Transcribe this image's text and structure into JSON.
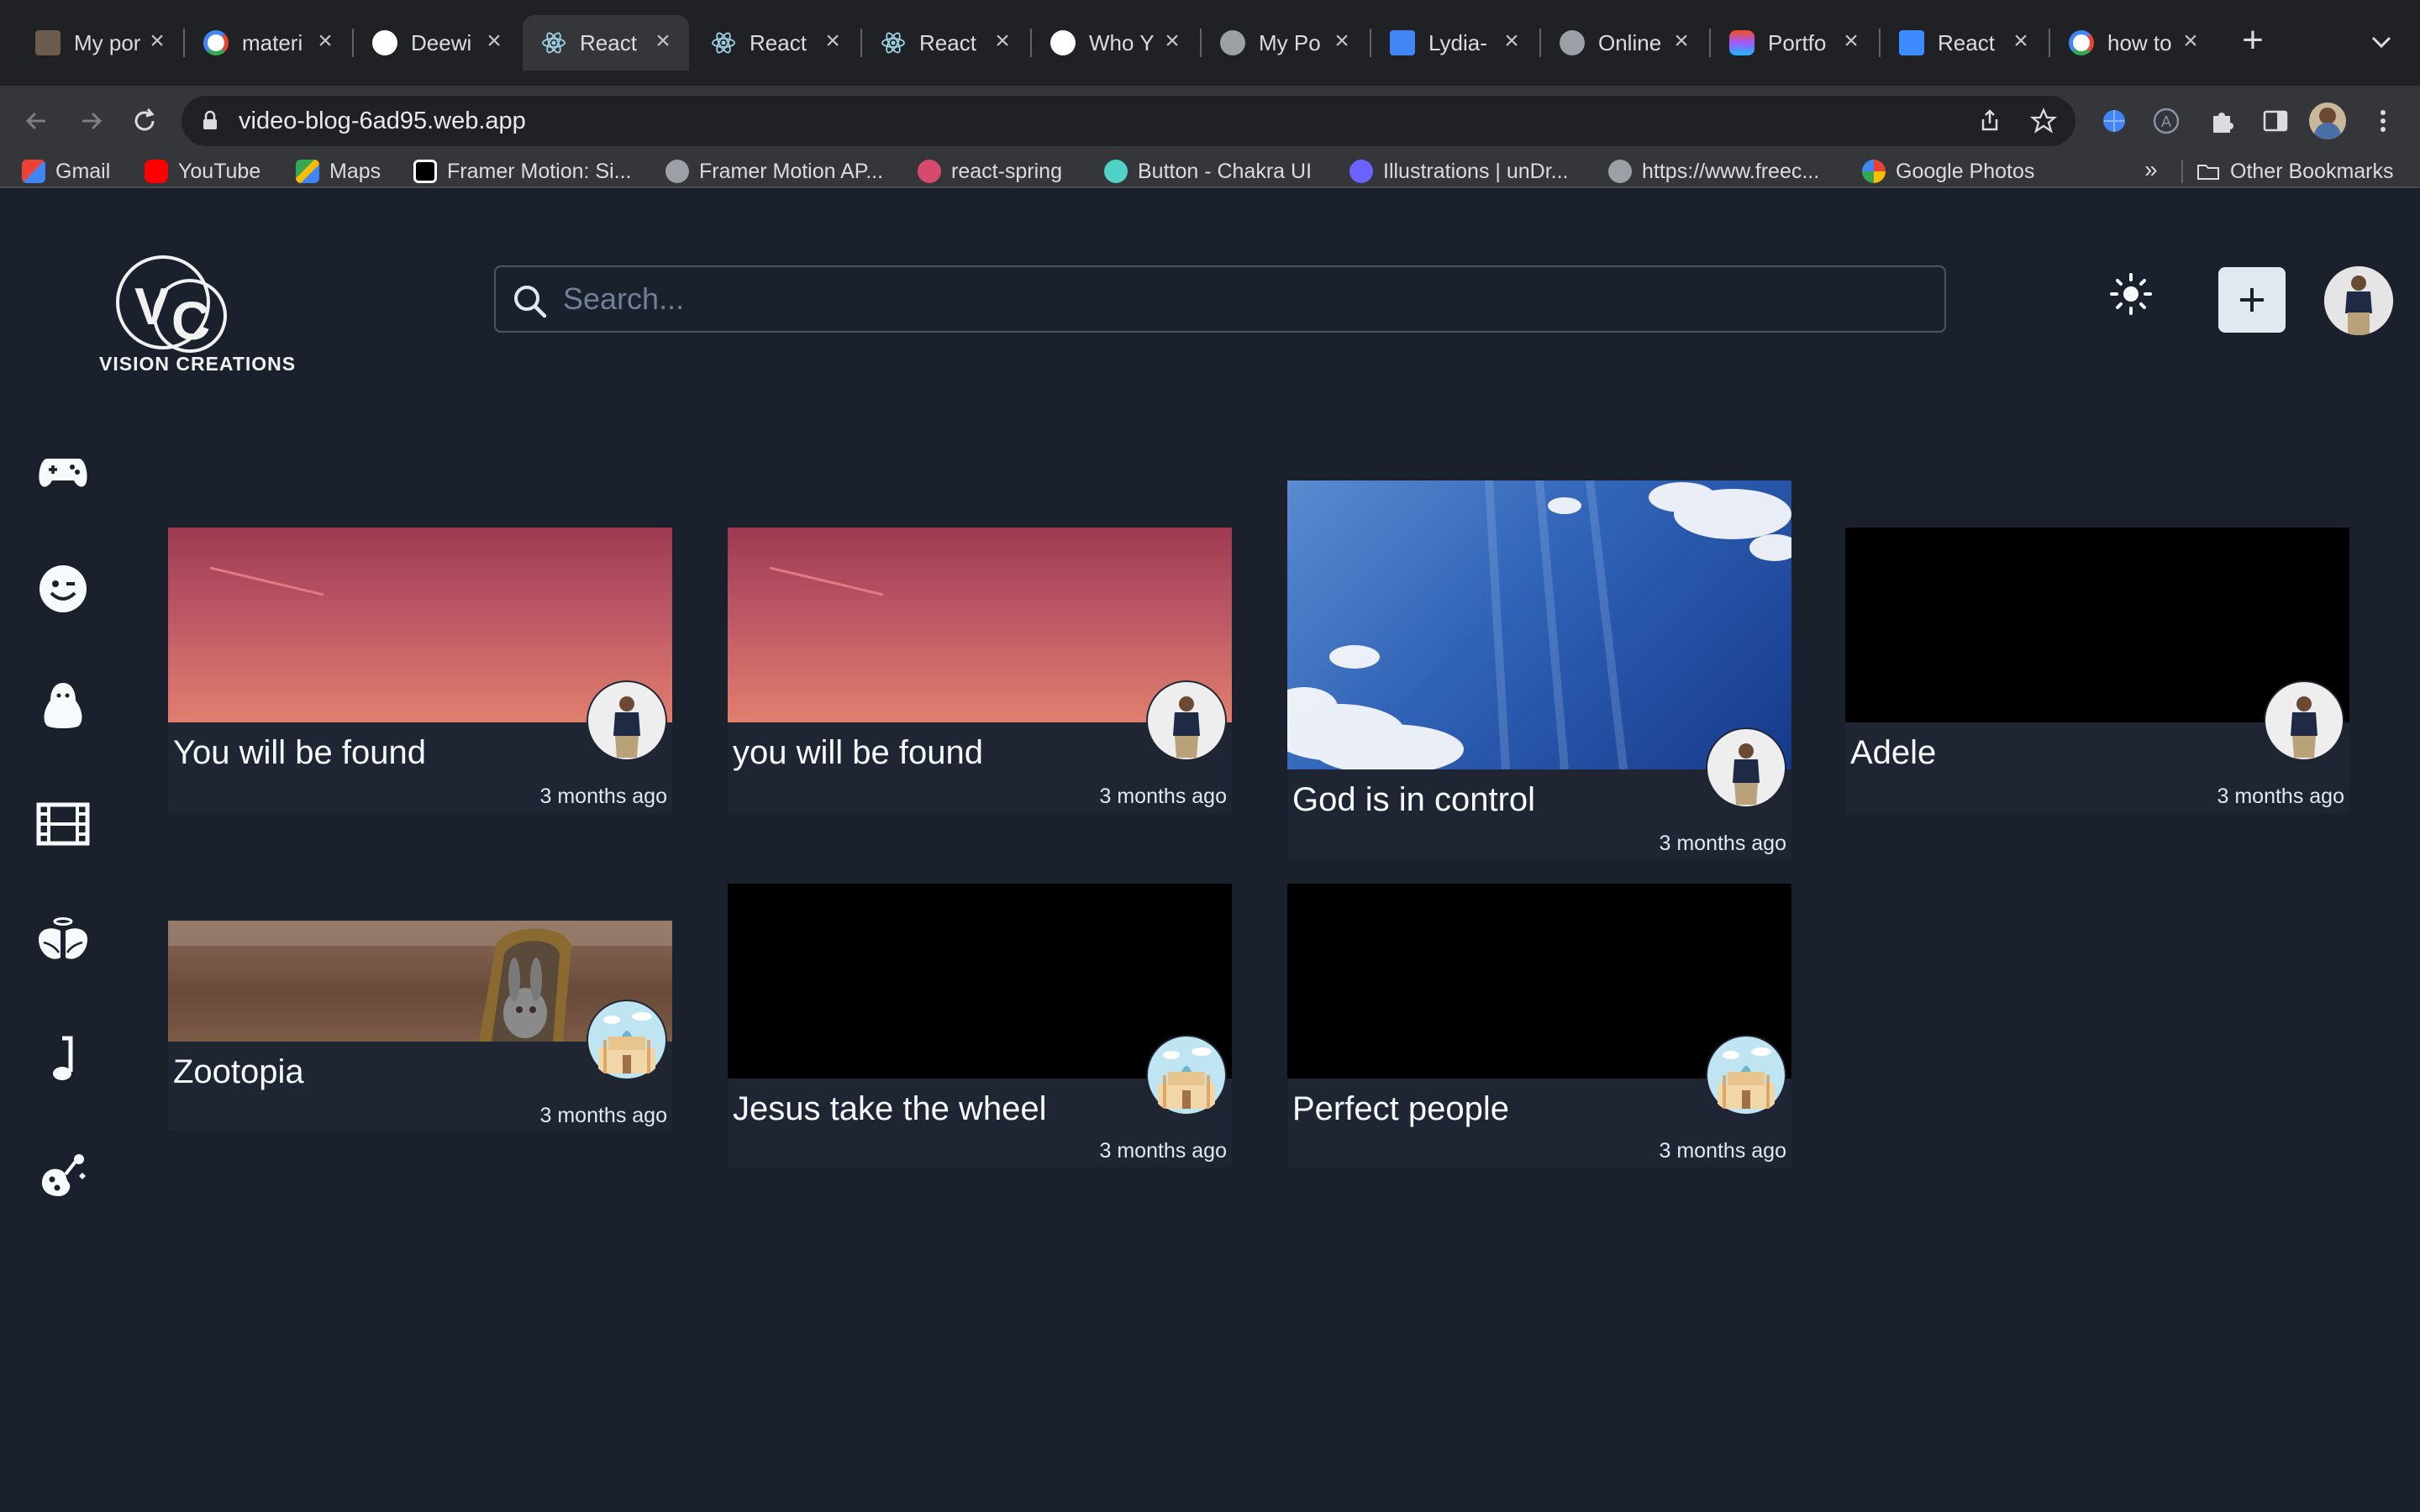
{
  "browser": {
    "tabs": [
      {
        "title": "My por",
        "icon": "photo-favicon",
        "color": "#6b5b4e",
        "active": false
      },
      {
        "title": "materi",
        "icon": "google-favicon",
        "color": "#ffffff",
        "active": false
      },
      {
        "title": "Deewi",
        "icon": "github-favicon",
        "color": "#ffffff",
        "active": false
      },
      {
        "title": "React",
        "icon": "react-favicon",
        "color": "#9fd4e6",
        "active": true
      },
      {
        "title": "React",
        "icon": "react-favicon",
        "color": "#9fd4e6",
        "active": false
      },
      {
        "title": "React",
        "icon": "react-favicon",
        "color": "#9fd4e6",
        "active": false
      },
      {
        "title": "Who Y",
        "icon": "github-favicon",
        "color": "#ffffff",
        "active": false
      },
      {
        "title": "My Po",
        "icon": "globe-favicon",
        "color": "#9aa0a6",
        "active": false
      },
      {
        "title": "Lydia-",
        "icon": "docs-favicon",
        "color": "#4285f4",
        "active": false
      },
      {
        "title": "Online",
        "icon": "globe-favicon",
        "color": "#9aa0a6",
        "active": false
      },
      {
        "title": "Portfo",
        "icon": "figma-favicon",
        "color": "#f24e1e",
        "active": false
      },
      {
        "title": "React",
        "icon": "mui-favicon",
        "color": "#3d8bff",
        "active": false
      },
      {
        "title": "how to",
        "icon": "google-favicon",
        "color": "#ffffff",
        "active": false
      }
    ],
    "url": "video-blog-6ad95.web.app",
    "bookmarks": [
      {
        "label": "Gmail",
        "icon": "gmail-icon",
        "color": "#ea4335"
      },
      {
        "label": "YouTube",
        "icon": "youtube-icon",
        "color": "#ff0000"
      },
      {
        "label": "Maps",
        "icon": "maps-icon",
        "color": "#34a853"
      },
      {
        "label": "Framer Motion: Si...",
        "icon": "framer-icon",
        "color": "#000000"
      },
      {
        "label": "Framer Motion AP...",
        "icon": "globe-icon",
        "color": "#9aa0a6"
      },
      {
        "label": "react-spring",
        "icon": "react-spring-icon",
        "color": "#d64a6b"
      },
      {
        "label": "Button - Chakra UI",
        "icon": "chakra-icon",
        "color": "#4fd1c5"
      },
      {
        "label": "Illustrations | unDr...",
        "icon": "undraw-icon",
        "color": "#6c63ff"
      },
      {
        "label": "https://www.freec...",
        "icon": "globe-icon",
        "color": "#9aa0a6"
      },
      {
        "label": "Google Photos",
        "icon": "google-photos-icon",
        "color": "#fbbc04"
      }
    ],
    "overflow_label": "»",
    "other_bookmarks": "Other Bookmarks"
  },
  "app": {
    "logo_text": "VISION CREATIONS",
    "logo_letters": "VC",
    "search": {
      "placeholder": "Search..."
    },
    "categories": [
      {
        "name": "games",
        "icon": "gamepad-icon"
      },
      {
        "name": "fun",
        "icon": "smiley-icon"
      },
      {
        "name": "linux",
        "icon": "penguin-icon"
      },
      {
        "name": "movies",
        "icon": "film-icon"
      },
      {
        "name": "spiritual",
        "icon": "angel-wings-icon"
      },
      {
        "name": "music",
        "icon": "music-note-icon"
      },
      {
        "name": "creative",
        "icon": "palette-icon"
      }
    ],
    "videos": [
      {
        "title": "You will be found",
        "time": "3 months ago",
        "thumb": "sunset",
        "owner": "man-avatar"
      },
      {
        "title": "you will be found",
        "time": "3 months ago",
        "thumb": "sunset",
        "owner": "man-avatar"
      },
      {
        "title": "God is in control",
        "time": "3 months ago",
        "thumb": "sky",
        "owner": "man-avatar"
      },
      {
        "title": "Adele",
        "time": "3 months ago",
        "thumb": "black",
        "owner": "man-avatar"
      },
      {
        "title": "Zootopia",
        "time": "3 months ago",
        "thumb": "zootopia",
        "owner": "building-avatar"
      },
      {
        "title": "Jesus take the wheel",
        "time": "3 months ago",
        "thumb": "black",
        "owner": "building-avatar"
      },
      {
        "title": "Perfect people",
        "time": "3 months ago",
        "thumb": "black",
        "owner": "building-avatar"
      }
    ]
  }
}
